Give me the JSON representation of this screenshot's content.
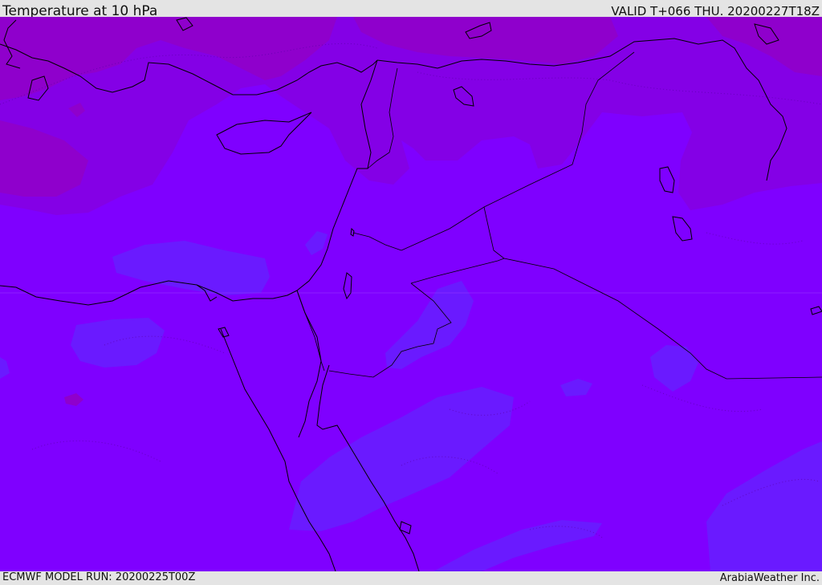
{
  "header": {
    "title": "Temperature at 10 hPa",
    "valid": "VALID T+066 THU. 20200227T18Z"
  },
  "footer": {
    "model_run": "ECMWF MODEL RUN: 20200225T00Z",
    "credit": "ArabiaWeather Inc."
  },
  "map": {
    "colors": {
      "base": "#7f00ff",
      "warm_band": "#8f00cc",
      "warmer_band": "#8400e6",
      "cool_band": "#6a1aff",
      "coastline": "#000000"
    }
  }
}
